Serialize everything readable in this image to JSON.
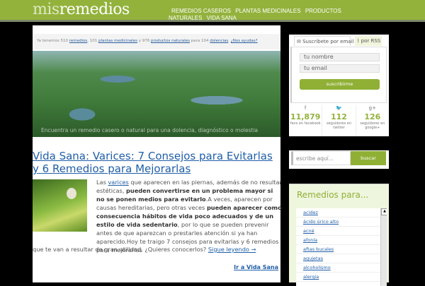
{
  "header": {
    "logo_a": "mis",
    "logo_b": "remedios",
    "nav": [
      "REMEDIOS CASEROS",
      "PLANTAS MEDICINALES",
      "PRODUCTOS NATURALES",
      "VIDA SANA"
    ]
  },
  "notice": {
    "t1": "Ya tenemos 510 ",
    "l1": "remedios",
    "t2": ", 101 ",
    "l2": "plantas medicinales",
    "t3": " y 976 ",
    "l3": "productos naturales",
    "t4": " para 104 ",
    "l4": "dolencias",
    "t5": ". ",
    "l5": "¿Nos ayudas?"
  },
  "hero": {
    "text": "Encuentra un remedio casero o natural para una dolencia, diagnóstico o molestia"
  },
  "post": {
    "title": "Vida Sana: Varices: 7 Consejos para Evitarlas y 6 Remedios para Mejorarlas",
    "p1": "Las ",
    "link": "varices",
    "p2": " que aparecen en las piernas, además de no resultar estéticas, ",
    "b1": "pueden convertirse en un problema mayor si no se ponen medios para evitarlo",
    "p3": ".A veces, aparecen por causas hereditarias, pero otras veces ",
    "b2": "pueden aparecer como consecuencia hábitos de vida poco adecuados y de un estilo de vida sedentario",
    "p4": ", por lo que se pueden prevenir antes de que aparezcan o prestarles atención si ya han aparecido.Hoy te traigo 7 consejos para evitarlas y 6 remedios para mejorarlas",
    "p5": "que te van a resultar de gran utilidad. ¿Quieres conocerlos? ",
    "more": "Sigue leyendo →",
    "goto": "Ir a Vida Sana"
  },
  "subscribe": {
    "tab_email": "Suscribete por email",
    "tab_rss": "por RSS",
    "name_ph": "tu nombre",
    "email_ph": "tu email",
    "button": "suscribirme"
  },
  "stats": [
    {
      "n": "11,879",
      "l": "fans en facebook"
    },
    {
      "n": "112",
      "l": "seguidores en twitter"
    },
    {
      "n": "126",
      "l": "seguidores en google+"
    }
  ],
  "search": {
    "placeholder": "escribe aquí...",
    "button": "buscar"
  },
  "remedios": {
    "title": "Remedios para...",
    "items": [
      "acidez",
      "ácido úrico alto",
      "acné",
      "afonía",
      "aftas bucales",
      "agujetas",
      "alcoholismo",
      "alergia"
    ]
  }
}
